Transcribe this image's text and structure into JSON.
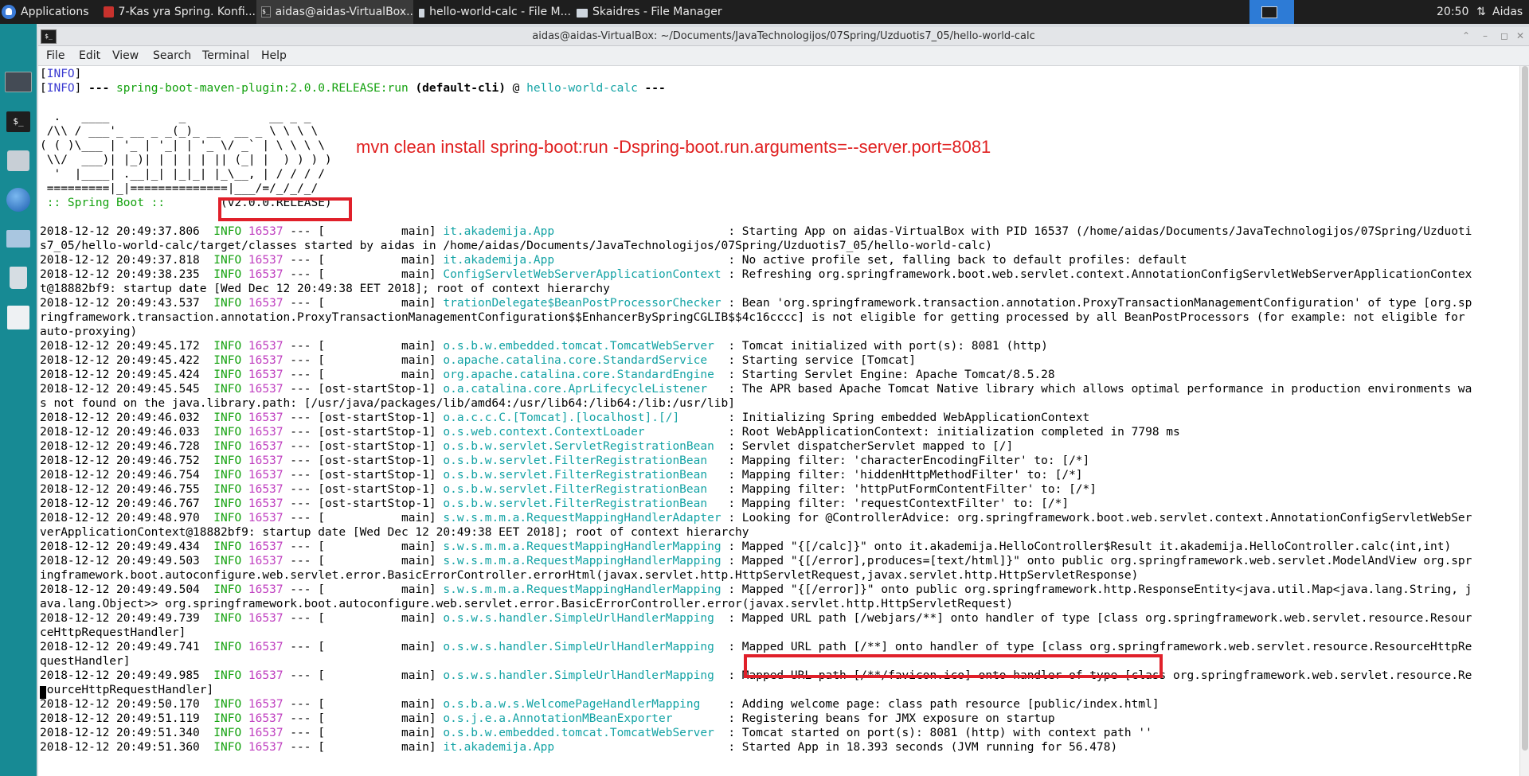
{
  "panel": {
    "apps_label": "Applications",
    "tasks": [
      {
        "label": "7-Kas yra Spring. Konfi...",
        "icon": "browser-icon"
      },
      {
        "label": "aidas@aidas-VirtualBox...",
        "icon": "terminal-icon",
        "active": true
      },
      {
        "label": "hello-world-calc - File M...",
        "icon": "folder-icon"
      },
      {
        "label": "Skaidres - File Manager",
        "icon": "folder-icon"
      }
    ],
    "clock": "20:50",
    "user": "Aidas"
  },
  "window": {
    "title": "aidas@aidas-VirtualBox: ~/Documents/JavaTechnologijos/07Spring/Uzduotis7_05/hello-world-calc",
    "menu": [
      "File",
      "Edit",
      "View",
      "Search",
      "Terminal",
      "Help"
    ]
  },
  "terminal": {
    "pre": [
      [
        {
          "t": "["
        },
        {
          "t": "INFO",
          "c": "blue"
        },
        {
          "t": "]"
        }
      ],
      [
        {
          "t": "["
        },
        {
          "t": "INFO",
          "c": "blue"
        },
        {
          "t": "] "
        },
        {
          "t": "--- ",
          "c": "b"
        },
        {
          "t": "spring-boot-maven-plugin:2.0.0.RELEASE:run",
          "c": "grn"
        },
        {
          "t": " "
        },
        {
          "t": "(default-cli)",
          "c": "b"
        },
        {
          "t": " @ "
        },
        {
          "t": "hello-world-calc",
          "c": "cyan"
        },
        {
          "t": " ---",
          "c": "b"
        }
      ],
      [
        {
          "t": ""
        }
      ],
      [
        {
          "t": "  .   ____          _            __ _ _"
        }
      ],
      [
        {
          "t": " /\\\\ / ___'_ __ _ _(_)_ __  __ _ \\ \\ \\ \\"
        }
      ],
      [
        {
          "t": "( ( )\\___ | '_ | '_| | '_ \\/ _` | \\ \\ \\ \\"
        }
      ],
      [
        {
          "t": " \\\\/  ___)| |_)| | | | | || (_| |  ) ) ) )"
        }
      ],
      [
        {
          "t": "  '  |____| .__|_| |_|_| |_\\__, | / / / /"
        }
      ],
      [
        {
          "t": " =========|_|==============|___/=/_/_/_/"
        }
      ],
      [
        {
          "t": " :: Spring Boot :: ",
          "c": "grn"
        },
        {
          "t": "       (v2.0.0.RELEASE)"
        }
      ],
      [
        {
          "t": ""
        }
      ]
    ],
    "logs": [
      {
        "ts": "2018-12-12 20:49:37.806",
        "pid": "16537",
        "th": "[           main]",
        "lg": "it.akademija.App                        ",
        "msg": ": Starting App on aidas-VirtualBox with PID 16537 (/home/aidas/Documents/JavaTechnologijos/07Spring/Uzduoti",
        "cont": [
          "s7_05/hello-world-calc/target/classes started by aidas in /home/aidas/Documents/JavaTechnologijos/07Spring/Uzduotis7_05/hello-world-calc)"
        ]
      },
      {
        "ts": "2018-12-12 20:49:37.818",
        "pid": "16537",
        "th": "[           main]",
        "lg": "it.akademija.App                        ",
        "msg": ": No active profile set, falling back to default profiles: default"
      },
      {
        "ts": "2018-12-12 20:49:38.235",
        "pid": "16537",
        "th": "[           main]",
        "lg": "ConfigServletWebServerApplicationContext",
        "msg": ": Refreshing org.springframework.boot.web.servlet.context.AnnotationConfigServletWebServerApplicationContex",
        "cont": [
          "t@18882bf9: startup date [Wed Dec 12 20:49:38 EET 2018]; root of context hierarchy"
        ]
      },
      {
        "ts": "2018-12-12 20:49:43.537",
        "pid": "16537",
        "th": "[           main]",
        "lg": "trationDelegate$BeanPostProcessorChecker",
        "msg": ": Bean 'org.springframework.transaction.annotation.ProxyTransactionManagementConfiguration' of type [org.sp",
        "cont": [
          "ringframework.transaction.annotation.ProxyTransactionManagementConfiguration$$EnhancerBySpringCGLIB$$4c16cccc] is not eligible for getting processed by all BeanPostProcessors (for example: not eligible for",
          "auto-proxying)"
        ]
      },
      {
        "ts": "2018-12-12 20:49:45.172",
        "pid": "16537",
        "th": "[           main]",
        "lg": "o.s.b.w.embedded.tomcat.TomcatWebServer ",
        "msg": ": Tomcat initialized with port(s): 8081 (http)"
      },
      {
        "ts": "2018-12-12 20:49:45.422",
        "pid": "16537",
        "th": "[           main]",
        "lg": "o.apache.catalina.core.StandardService  ",
        "msg": ": Starting service [Tomcat]"
      },
      {
        "ts": "2018-12-12 20:49:45.424",
        "pid": "16537",
        "th": "[           main]",
        "lg": "org.apache.catalina.core.StandardEngine ",
        "msg": ": Starting Servlet Engine: Apache Tomcat/8.5.28"
      },
      {
        "ts": "2018-12-12 20:49:45.545",
        "pid": "16537",
        "th": "[ost-startStop-1]",
        "lg": "o.a.catalina.core.AprLifecycleListener  ",
        "msg": ": The APR based Apache Tomcat Native library which allows optimal performance in production environments wa",
        "cont": [
          "s not found on the java.library.path: [/usr/java/packages/lib/amd64:/usr/lib64:/lib64:/lib:/usr/lib]"
        ]
      },
      {
        "ts": "2018-12-12 20:49:46.032",
        "pid": "16537",
        "th": "[ost-startStop-1]",
        "lg": "o.a.c.c.C.[Tomcat].[localhost].[/]      ",
        "msg": ": Initializing Spring embedded WebApplicationContext"
      },
      {
        "ts": "2018-12-12 20:49:46.033",
        "pid": "16537",
        "th": "[ost-startStop-1]",
        "lg": "o.s.web.context.ContextLoader           ",
        "msg": ": Root WebApplicationContext: initialization completed in 7798 ms"
      },
      {
        "ts": "2018-12-12 20:49:46.728",
        "pid": "16537",
        "th": "[ost-startStop-1]",
        "lg": "o.s.b.w.servlet.ServletRegistrationBean ",
        "msg": ": Servlet dispatcherServlet mapped to [/]"
      },
      {
        "ts": "2018-12-12 20:49:46.752",
        "pid": "16537",
        "th": "[ost-startStop-1]",
        "lg": "o.s.b.w.servlet.FilterRegistrationBean  ",
        "msg": ": Mapping filter: 'characterEncodingFilter' to: [/*]"
      },
      {
        "ts": "2018-12-12 20:49:46.754",
        "pid": "16537",
        "th": "[ost-startStop-1]",
        "lg": "o.s.b.w.servlet.FilterRegistrationBean  ",
        "msg": ": Mapping filter: 'hiddenHttpMethodFilter' to: [/*]"
      },
      {
        "ts": "2018-12-12 20:49:46.755",
        "pid": "16537",
        "th": "[ost-startStop-1]",
        "lg": "o.s.b.w.servlet.FilterRegistrationBean  ",
        "msg": ": Mapping filter: 'httpPutFormContentFilter' to: [/*]"
      },
      {
        "ts": "2018-12-12 20:49:46.767",
        "pid": "16537",
        "th": "[ost-startStop-1]",
        "lg": "o.s.b.w.servlet.FilterRegistrationBean  ",
        "msg": ": Mapping filter: 'requestContextFilter' to: [/*]"
      },
      {
        "ts": "2018-12-12 20:49:48.970",
        "pid": "16537",
        "th": "[           main]",
        "lg": "s.w.s.m.m.a.RequestMappingHandlerAdapter",
        "msg": ": Looking for @ControllerAdvice: org.springframework.boot.web.servlet.context.AnnotationConfigServletWebSer",
        "cont": [
          "verApplicationContext@18882bf9: startup date [Wed Dec 12 20:49:38 EET 2018]; root of context hierarchy"
        ]
      },
      {
        "ts": "2018-12-12 20:49:49.434",
        "pid": "16537",
        "th": "[           main]",
        "lg": "s.w.s.m.m.a.RequestMappingHandlerMapping",
        "msg": ": Mapped \"{[/calc]}\" onto it.akademija.HelloController$Result it.akademija.HelloController.calc(int,int)"
      },
      {
        "ts": "2018-12-12 20:49:49.503",
        "pid": "16537",
        "th": "[           main]",
        "lg": "s.w.s.m.m.a.RequestMappingHandlerMapping",
        "msg": ": Mapped \"{[/error],produces=[text/html]}\" onto public org.springframework.web.servlet.ModelAndView org.spr",
        "cont": [
          "ingframework.boot.autoconfigure.web.servlet.error.BasicErrorController.errorHtml(javax.servlet.http.HttpServletRequest,javax.servlet.http.HttpServletResponse)"
        ]
      },
      {
        "ts": "2018-12-12 20:49:49.504",
        "pid": "16537",
        "th": "[           main]",
        "lg": "s.w.s.m.m.a.RequestMappingHandlerMapping",
        "msg": ": Mapped \"{[/error]}\" onto public org.springframework.http.ResponseEntity<java.util.Map<java.lang.String, j",
        "cont": [
          "ava.lang.Object>> org.springframework.boot.autoconfigure.web.servlet.error.BasicErrorController.error(javax.servlet.http.HttpServletRequest)"
        ]
      },
      {
        "ts": "2018-12-12 20:49:49.739",
        "pid": "16537",
        "th": "[           main]",
        "lg": "o.s.w.s.handler.SimpleUrlHandlerMapping ",
        "msg": ": Mapped URL path [/webjars/**] onto handler of type [class org.springframework.web.servlet.resource.Resour",
        "cont": [
          "ceHttpRequestHandler]"
        ]
      },
      {
        "ts": "2018-12-12 20:49:49.741",
        "pid": "16537",
        "th": "[           main]",
        "lg": "o.s.w.s.handler.SimpleUrlHandlerMapping ",
        "msg": ": Mapped URL path [/**] onto handler of type [class org.springframework.web.servlet.resource.ResourceHttpRe",
        "cont": [
          "questHandler]"
        ]
      },
      {
        "ts": "2018-12-12 20:49:49.985",
        "pid": "16537",
        "th": "[           main]",
        "lg": "o.s.w.s.handler.SimpleUrlHandlerMapping ",
        "msg": ": Mapped URL path [/**/favicon.ico] onto handler of type [class org.springframework.web.servlet.resource.Re",
        "cont": [
          "sourceHttpRequestHandler]"
        ]
      },
      {
        "ts": "2018-12-12 20:49:50.170",
        "pid": "16537",
        "th": "[           main]",
        "lg": "o.s.b.a.w.s.WelcomePageHandlerMapping   ",
        "msg": ": Adding welcome page: class path resource [public/index.html]"
      },
      {
        "ts": "2018-12-12 20:49:51.119",
        "pid": "16537",
        "th": "[           main]",
        "lg": "o.s.j.e.a.AnnotationMBeanExporter       ",
        "msg": ": Registering beans for JMX exposure on startup"
      },
      {
        "ts": "2018-12-12 20:49:51.340",
        "pid": "16537",
        "th": "[           main]",
        "lg": "o.s.b.w.embedded.tomcat.TomcatWebServer ",
        "msg": ": Tomcat started on port(s): 8081 (http) with context path ''"
      },
      {
        "ts": "2018-12-12 20:49:51.360",
        "pid": "16537",
        "th": "[           main]",
        "lg": "it.akademija.App                        ",
        "msg": ": Started App in 18.393 seconds (JVM running for 56.478)"
      }
    ]
  },
  "annotation": "mvn clean install spring-boot:run -Dspring-boot.run.arguments=--server.port=8081",
  "colors": {
    "accent": "#e0202a",
    "log_level": "#13a10e",
    "logger": "#14a3a5",
    "pid": "#c040c0",
    "dock": "#178a94"
  }
}
